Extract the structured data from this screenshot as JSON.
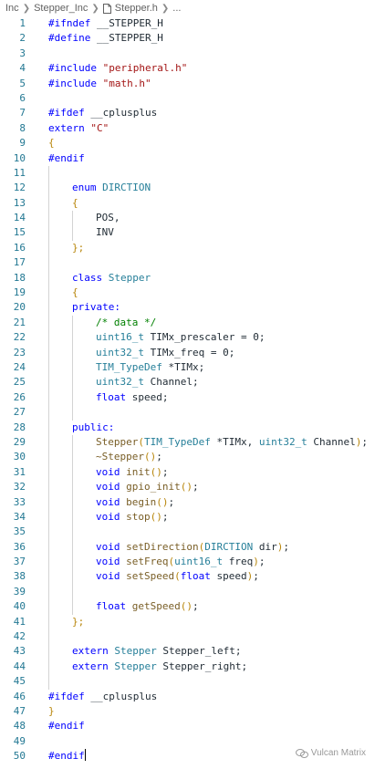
{
  "breadcrumb": {
    "items": [
      "Inc",
      "Stepper_Inc",
      "Stepper.h",
      "..."
    ]
  },
  "editor": {
    "lines": [
      {
        "n": "1",
        "indent": 0,
        "tokens": [
          {
            "t": "#ifndef",
            "c": "pp"
          },
          {
            "t": " __STEPPER_H"
          }
        ]
      },
      {
        "n": "2",
        "indent": 0,
        "tokens": [
          {
            "t": "#define",
            "c": "pp"
          },
          {
            "t": " __STEPPER_H"
          }
        ]
      },
      {
        "n": "3",
        "indent": 0,
        "tokens": []
      },
      {
        "n": "4",
        "indent": 0,
        "tokens": [
          {
            "t": "#include",
            "c": "pp"
          },
          {
            "t": " "
          },
          {
            "t": "\"peripheral.h\"",
            "c": "str"
          }
        ]
      },
      {
        "n": "5",
        "indent": 0,
        "tokens": [
          {
            "t": "#include",
            "c": "pp"
          },
          {
            "t": " "
          },
          {
            "t": "\"math.h\"",
            "c": "str"
          }
        ]
      },
      {
        "n": "6",
        "indent": 0,
        "tokens": []
      },
      {
        "n": "7",
        "indent": 0,
        "tokens": [
          {
            "t": "#ifdef",
            "c": "pp"
          },
          {
            "t": " __cplusplus"
          }
        ]
      },
      {
        "n": "8",
        "indent": 0,
        "tokens": [
          {
            "t": "extern",
            "c": "kw"
          },
          {
            "t": " "
          },
          {
            "t": "\"C\"",
            "c": "str"
          }
        ]
      },
      {
        "n": "9",
        "indent": 0,
        "tokens": [
          {
            "t": "{",
            "c": "br"
          }
        ]
      },
      {
        "n": "10",
        "indent": 0,
        "tokens": [
          {
            "t": "#endif",
            "c": "pp"
          }
        ]
      },
      {
        "n": "11",
        "indent": 0,
        "guides": 1,
        "tokens": []
      },
      {
        "n": "12",
        "indent": 1,
        "guides": 1,
        "tokens": [
          {
            "t": "enum",
            "c": "kw"
          },
          {
            "t": " "
          },
          {
            "t": "DIRCTION",
            "c": "ty"
          }
        ]
      },
      {
        "n": "13",
        "indent": 1,
        "guides": 1,
        "tokens": [
          {
            "t": "{",
            "c": "br"
          }
        ]
      },
      {
        "n": "14",
        "indent": 2,
        "guides": 2,
        "tokens": [
          {
            "t": "POS,"
          }
        ]
      },
      {
        "n": "15",
        "indent": 2,
        "guides": 2,
        "tokens": [
          {
            "t": "INV"
          }
        ]
      },
      {
        "n": "16",
        "indent": 1,
        "guides": 1,
        "tokens": [
          {
            "t": "};",
            "c": "br"
          }
        ]
      },
      {
        "n": "17",
        "indent": 0,
        "guides": 1,
        "tokens": []
      },
      {
        "n": "18",
        "indent": 1,
        "guides": 1,
        "tokens": [
          {
            "t": "class",
            "c": "kw"
          },
          {
            "t": " "
          },
          {
            "t": "Stepper",
            "c": "ty"
          }
        ]
      },
      {
        "n": "19",
        "indent": 1,
        "guides": 1,
        "tokens": [
          {
            "t": "{",
            "c": "br"
          }
        ]
      },
      {
        "n": "20",
        "indent": 1,
        "guides": 1,
        "tokens": [
          {
            "t": "private:",
            "c": "kw"
          }
        ]
      },
      {
        "n": "21",
        "indent": 2,
        "guides": 2,
        "tokens": [
          {
            "t": "/* data */",
            "c": "cm"
          }
        ]
      },
      {
        "n": "22",
        "indent": 2,
        "guides": 2,
        "tokens": [
          {
            "t": "uint16_t",
            "c": "ty"
          },
          {
            "t": " TIMx_prescaler = 0;"
          }
        ]
      },
      {
        "n": "23",
        "indent": 2,
        "guides": 2,
        "tokens": [
          {
            "t": "uint32_t",
            "c": "ty"
          },
          {
            "t": " TIMx_freq = 0;"
          }
        ]
      },
      {
        "n": "24",
        "indent": 2,
        "guides": 2,
        "tokens": [
          {
            "t": "TIM_TypeDef",
            "c": "ty"
          },
          {
            "t": " *TIMx;"
          }
        ]
      },
      {
        "n": "25",
        "indent": 2,
        "guides": 2,
        "tokens": [
          {
            "t": "uint32_t",
            "c": "ty"
          },
          {
            "t": " Channel;"
          }
        ]
      },
      {
        "n": "26",
        "indent": 2,
        "guides": 2,
        "tokens": [
          {
            "t": "float",
            "c": "kw"
          },
          {
            "t": " speed;"
          }
        ]
      },
      {
        "n": "27",
        "indent": 0,
        "guides": 2,
        "tokens": []
      },
      {
        "n": "28",
        "indent": 1,
        "guides": 1,
        "tokens": [
          {
            "t": "public:",
            "c": "kw"
          }
        ]
      },
      {
        "n": "29",
        "indent": 2,
        "guides": 2,
        "tokens": [
          {
            "t": "Stepper",
            "c": "fn"
          },
          {
            "t": "(",
            "c": "br"
          },
          {
            "t": "TIM_TypeDef",
            "c": "ty"
          },
          {
            "t": " *TIMx, "
          },
          {
            "t": "uint32_t",
            "c": "ty"
          },
          {
            "t": " Channel"
          },
          {
            "t": ")",
            "c": "br"
          },
          {
            "t": ";"
          }
        ]
      },
      {
        "n": "30",
        "indent": 2,
        "guides": 2,
        "tokens": [
          {
            "t": "~Stepper",
            "c": "fn"
          },
          {
            "t": "()",
            "c": "br"
          },
          {
            "t": ";"
          }
        ]
      },
      {
        "n": "31",
        "indent": 2,
        "guides": 2,
        "tokens": [
          {
            "t": "void",
            "c": "kw"
          },
          {
            "t": " "
          },
          {
            "t": "init",
            "c": "fn"
          },
          {
            "t": "()",
            "c": "br"
          },
          {
            "t": ";"
          }
        ]
      },
      {
        "n": "32",
        "indent": 2,
        "guides": 2,
        "tokens": [
          {
            "t": "void",
            "c": "kw"
          },
          {
            "t": " "
          },
          {
            "t": "gpio_init",
            "c": "fn"
          },
          {
            "t": "()",
            "c": "br"
          },
          {
            "t": ";"
          }
        ]
      },
      {
        "n": "33",
        "indent": 2,
        "guides": 2,
        "tokens": [
          {
            "t": "void",
            "c": "kw"
          },
          {
            "t": " "
          },
          {
            "t": "begin",
            "c": "fn"
          },
          {
            "t": "()",
            "c": "br"
          },
          {
            "t": ";"
          }
        ]
      },
      {
        "n": "34",
        "indent": 2,
        "guides": 2,
        "tokens": [
          {
            "t": "void",
            "c": "kw"
          },
          {
            "t": " "
          },
          {
            "t": "stop",
            "c": "fn"
          },
          {
            "t": "()",
            "c": "br"
          },
          {
            "t": ";"
          }
        ]
      },
      {
        "n": "35",
        "indent": 0,
        "guides": 2,
        "tokens": []
      },
      {
        "n": "36",
        "indent": 2,
        "guides": 2,
        "tokens": [
          {
            "t": "void",
            "c": "kw"
          },
          {
            "t": " "
          },
          {
            "t": "setDirection",
            "c": "fn"
          },
          {
            "t": "(",
            "c": "br"
          },
          {
            "t": "DIRCTION",
            "c": "ty"
          },
          {
            "t": " dir"
          },
          {
            "t": ")",
            "c": "br"
          },
          {
            "t": ";"
          }
        ]
      },
      {
        "n": "37",
        "indent": 2,
        "guides": 2,
        "tokens": [
          {
            "t": "void",
            "c": "kw"
          },
          {
            "t": " "
          },
          {
            "t": "setFreq",
            "c": "fn"
          },
          {
            "t": "(",
            "c": "br"
          },
          {
            "t": "uint16_t",
            "c": "ty"
          },
          {
            "t": " freq"
          },
          {
            "t": ")",
            "c": "br"
          },
          {
            "t": ";"
          }
        ]
      },
      {
        "n": "38",
        "indent": 2,
        "guides": 2,
        "tokens": [
          {
            "t": "void",
            "c": "kw"
          },
          {
            "t": " "
          },
          {
            "t": "setSpeed",
            "c": "fn"
          },
          {
            "t": "(",
            "c": "br"
          },
          {
            "t": "float",
            "c": "kw"
          },
          {
            "t": " speed"
          },
          {
            "t": ")",
            "c": "br"
          },
          {
            "t": ";"
          }
        ]
      },
      {
        "n": "39",
        "indent": 0,
        "guides": 2,
        "tokens": []
      },
      {
        "n": "40",
        "indent": 2,
        "guides": 2,
        "tokens": [
          {
            "t": "float",
            "c": "kw"
          },
          {
            "t": " "
          },
          {
            "t": "getSpeed",
            "c": "fn"
          },
          {
            "t": "()",
            "c": "br"
          },
          {
            "t": ";"
          }
        ]
      },
      {
        "n": "41",
        "indent": 1,
        "guides": 1,
        "tokens": [
          {
            "t": "};",
            "c": "br"
          }
        ]
      },
      {
        "n": "42",
        "indent": 0,
        "guides": 1,
        "tokens": []
      },
      {
        "n": "43",
        "indent": 1,
        "guides": 1,
        "tokens": [
          {
            "t": "extern",
            "c": "kw"
          },
          {
            "t": " "
          },
          {
            "t": "Stepper",
            "c": "ty"
          },
          {
            "t": " Stepper_left;"
          }
        ]
      },
      {
        "n": "44",
        "indent": 1,
        "guides": 1,
        "tokens": [
          {
            "t": "extern",
            "c": "kw"
          },
          {
            "t": " "
          },
          {
            "t": "Stepper",
            "c": "ty"
          },
          {
            "t": " Stepper_right;"
          }
        ]
      },
      {
        "n": "45",
        "indent": 0,
        "guides": 1,
        "tokens": []
      },
      {
        "n": "46",
        "indent": 0,
        "tokens": [
          {
            "t": "#ifdef",
            "c": "pp"
          },
          {
            "t": " __cplusplus"
          }
        ]
      },
      {
        "n": "47",
        "indent": 0,
        "tokens": [
          {
            "t": "}",
            "c": "br"
          }
        ]
      },
      {
        "n": "48",
        "indent": 0,
        "tokens": [
          {
            "t": "#endif",
            "c": "pp"
          }
        ]
      },
      {
        "n": "49",
        "indent": 0,
        "tokens": []
      },
      {
        "n": "50",
        "indent": 0,
        "caret": true,
        "tokens": [
          {
            "t": "#endif",
            "c": "pp"
          }
        ]
      }
    ]
  },
  "watermark": {
    "text": "Vulcan Matrix",
    "icon": "wechat-icon"
  },
  "colors": {
    "line_number": "#237893",
    "keyword": "#0000ff",
    "string": "#a31515",
    "type": "#267f99",
    "function": "#795e26",
    "comment": "#008000"
  }
}
